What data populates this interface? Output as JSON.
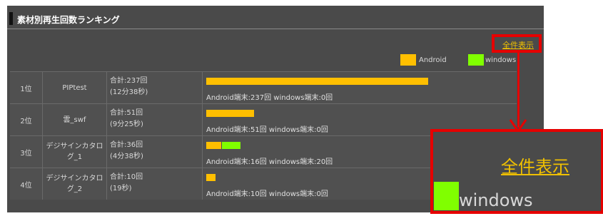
{
  "panel": {
    "title": "素材別再生回数ランキング",
    "show_all_label": "全件表示"
  },
  "legend": [
    {
      "label": "Android",
      "color": "#ffbf00"
    },
    {
      "label": "windows",
      "color": "#80ff00"
    }
  ],
  "ranking": [
    {
      "rank": "1位",
      "name": "PIPtest",
      "total": "合計:237回",
      "duration": "(12分38秒)",
      "android": 237,
      "windows": 0,
      "breakdown": "Android端末:237回 windows端末:0回"
    },
    {
      "rank": "2位",
      "name": "雲_swf",
      "total": "合計:51回",
      "duration": "(9分25秒)",
      "android": 51,
      "windows": 0,
      "breakdown": "Android端末:51回 windows端末:0回"
    },
    {
      "rank": "3位",
      "name": "デジサインカタログ_1",
      "total": "合計:36回",
      "duration": "(4分38秒)",
      "android": 16,
      "windows": 20,
      "breakdown": "Android端末:16回 windows端末:20回"
    },
    {
      "rank": "4位",
      "name": "デジサインカタログ_2",
      "total": "合計:10回",
      "duration": "(19秒)",
      "android": 10,
      "windows": 0,
      "breakdown": "Android端末:10回 windows端末:0回"
    }
  ],
  "zoom_callout": {
    "show_all_label": "全件表示",
    "legend_label": "windows",
    "highlight_color": "#e60000"
  }
}
